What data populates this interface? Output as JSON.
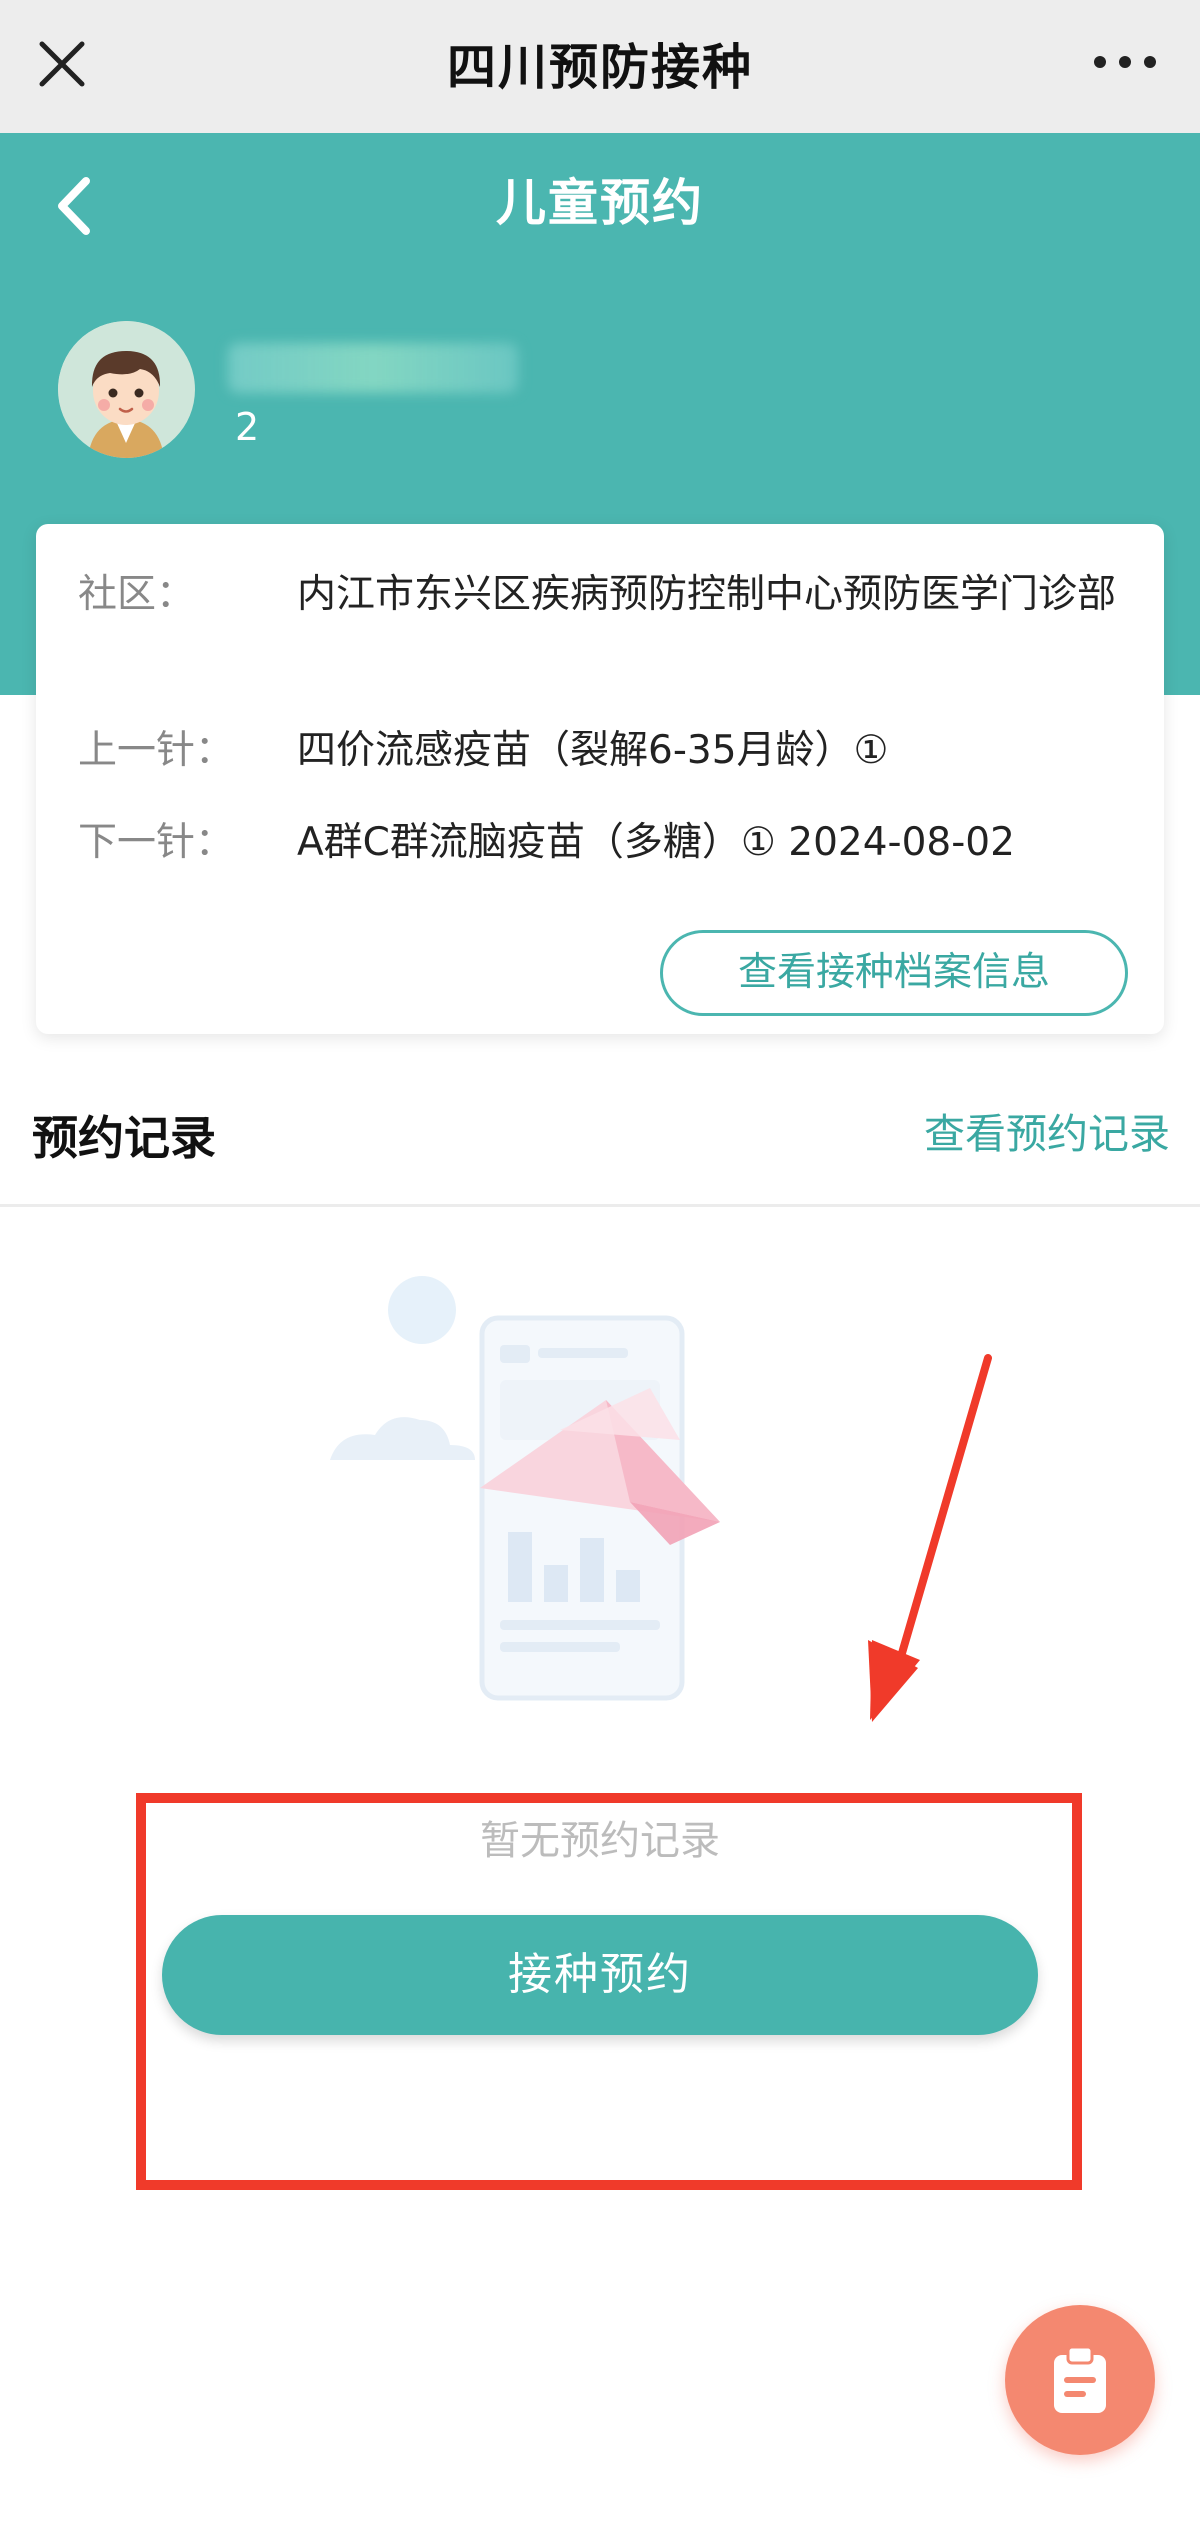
{
  "nav": {
    "title": "四川预防接种",
    "close_icon": "close-icon",
    "more_icon": "more-icon"
  },
  "header": {
    "title": "儿童预约",
    "child_age": "2"
  },
  "info": {
    "community_label": "社区：",
    "community_value": "内江市东兴区疾病预防控制中心预防医学门诊部",
    "last_label": "上一针：",
    "last_value": "四价流感疫苗（裂解6-35月龄）①",
    "next_label": "下一针：",
    "next_value": "A群C群流脑疫苗（多糖）① 2024-08-02",
    "archive_button": "查看接种档案信息"
  },
  "records": {
    "title": "预约记录",
    "link": "查看预约记录",
    "empty_text": "暂无预约记录"
  },
  "action": {
    "book_button": "接种预约"
  },
  "colors": {
    "teal": "#4bb6b0",
    "highlight_red": "#f03a2a",
    "fab": "#f48870"
  }
}
